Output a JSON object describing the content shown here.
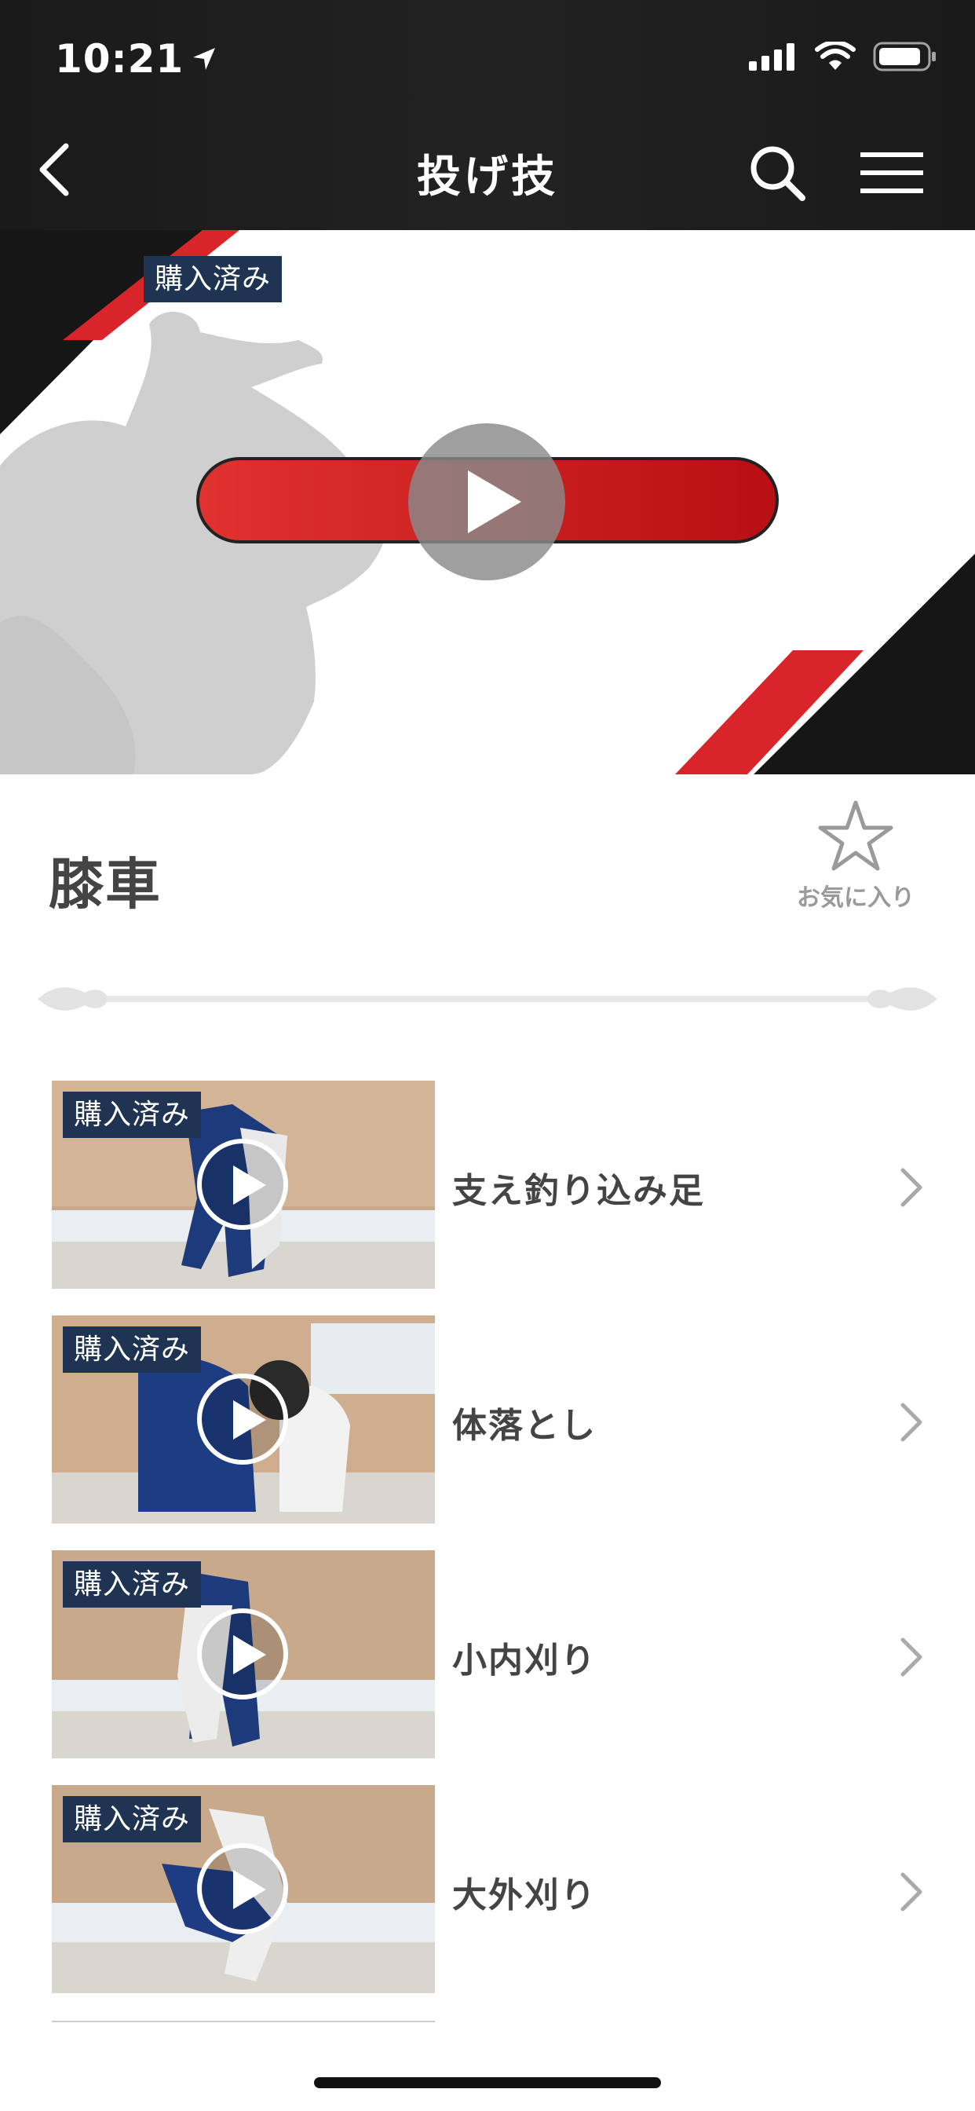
{
  "status_bar": {
    "time": "10:21"
  },
  "nav": {
    "title": "投げ技"
  },
  "hero": {
    "badge": "購入済み"
  },
  "technique": {
    "title": "膝車",
    "favorite_label": "お気に入り"
  },
  "videos": [
    {
      "badge": "購入済み",
      "title": "支え釣り込み足"
    },
    {
      "badge": "購入済み",
      "title": "体落とし"
    },
    {
      "badge": "購入済み",
      "title": "小内刈り"
    },
    {
      "badge": "購入済み",
      "title": "大外刈り"
    }
  ],
  "colors": {
    "badge_bg": "#1f3453",
    "accent_red": "#d9252a",
    "topbar": "#1c1c1c"
  }
}
